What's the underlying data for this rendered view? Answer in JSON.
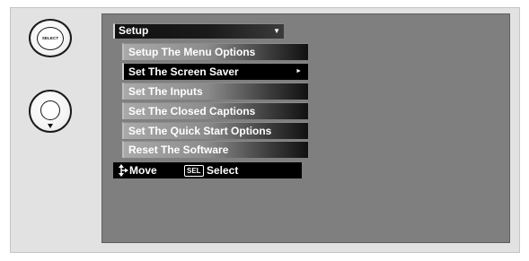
{
  "remote": {
    "select_label": "SELECT"
  },
  "menu": {
    "title": "Setup",
    "title_caret": "▼",
    "items": [
      {
        "label": "Setup The Menu Options",
        "selected": false,
        "has_submenu": false
      },
      {
        "label": "Set The Screen Saver",
        "selected": true,
        "has_submenu": true,
        "submenu_arrow": "►"
      },
      {
        "label": "Set The Inputs",
        "selected": false,
        "has_submenu": false
      },
      {
        "label": "Set The Closed Captions",
        "selected": false,
        "has_submenu": false
      },
      {
        "label": "Set The Quick Start Options",
        "selected": false,
        "has_submenu": false
      },
      {
        "label": "Reset The Software",
        "selected": false,
        "has_submenu": false
      }
    ]
  },
  "help_bar": {
    "move_label": "Move",
    "sel_key": "SEL",
    "select_label": "Select"
  },
  "colors": {
    "screen_background": "#7f7f7f",
    "selected_item_background": "#000000",
    "panel_background": "#e2e2e2"
  },
  "icons": {
    "select_button": "select-button-icon",
    "dpad_button": "dpad-down-icon",
    "move": "move-arrows-icon",
    "submenu": "chevron-right-icon",
    "dropdown": "caret-down-icon"
  }
}
